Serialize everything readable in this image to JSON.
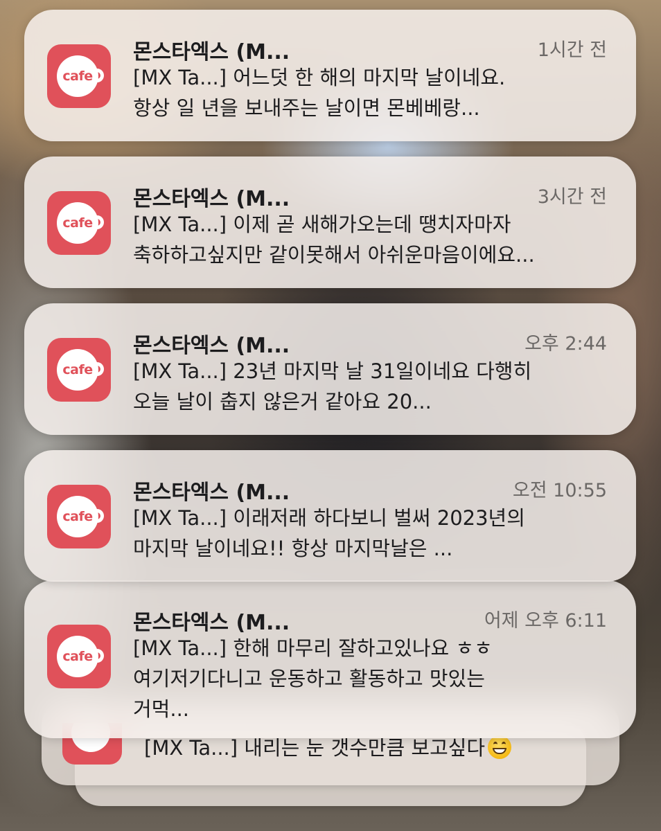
{
  "notifications": [
    {
      "app_icon": "cafe-app-icon",
      "icon_label": "cafe",
      "title": "몬스타엑스 (M...",
      "time": "1시간 전",
      "body": "[MX Ta...] 어느덧 한 해의 마지막 날이네요.\n항상 일 년을 보내주는 날이면 몬베베랑..."
    },
    {
      "app_icon": "cafe-app-icon",
      "icon_label": "cafe",
      "title": "몬스타엑스 (M...",
      "time": "3시간 전",
      "body": "[MX Ta...] 이제 곧 새해가오는데 땡치자마자\n축하하고싶지만 같이못해서 아쉬운마음이에요..."
    },
    {
      "app_icon": "cafe-app-icon",
      "icon_label": "cafe",
      "title": "몬스타엑스 (M...",
      "time": "오후 2:44",
      "body": "[MX Ta...] 23년 마지막 날 31일이네요 다행히\n오늘 날이 춥지 않은거 같아요 20..."
    },
    {
      "app_icon": "cafe-app-icon",
      "icon_label": "cafe",
      "title": "몬스타엑스 (M...",
      "time": "오전 10:55",
      "body": "[MX Ta...] 이래저래 하다보니 벌써 2023년의\n마지막 날이네요!! 항상 마지막날은 ..."
    },
    {
      "app_icon": "cafe-app-icon",
      "icon_label": "cafe",
      "title": "몬스타엑스 (M...",
      "time": "어제 오후 6:11",
      "body": "[MX Ta...] 한해 마무리 잘하고있나요 ㅎㅎ\n여기저기다니고 운동하고 활동하고 맛있는\n거먹..."
    }
  ],
  "stacked_notification": {
    "app_icon": "cafe-app-icon",
    "body": "[MX Ta...] 내리는 눈 갯수만큼 보고싶다",
    "emoji": "grinning-face-with-smiling-eyes-emoji"
  },
  "colors": {
    "app_icon_red": "#e0515a",
    "card_background": "#f6f0ec",
    "timestamp_gray": "#6b6866",
    "text_dark": "#1c1c1e"
  }
}
